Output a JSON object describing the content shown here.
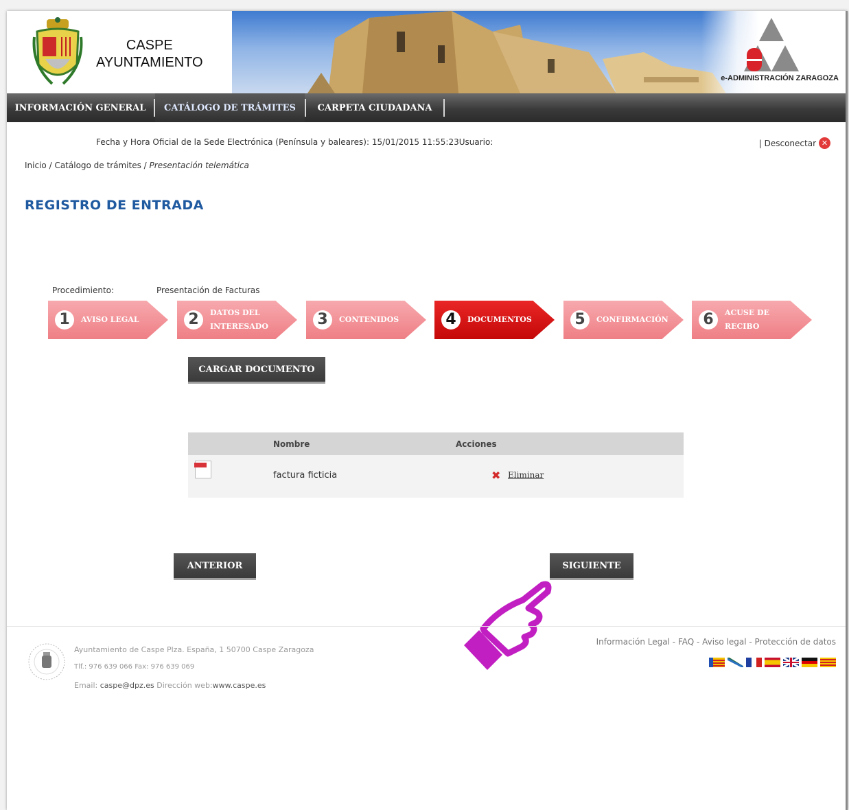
{
  "header": {
    "brand_line1": "CASPE",
    "brand_line2": "AYUNTAMIENTO",
    "eadmin": "e-ADMINISTRACIÓN ZARAGOZA"
  },
  "nav": {
    "items": [
      {
        "label": "INFORMACIÓN GENERAL"
      },
      {
        "label": "CATÁLOGO DE TRÁMITES"
      },
      {
        "label": "CARPETA CIUDADANA"
      }
    ]
  },
  "info": {
    "datetime_label": "Fecha y Hora Oficial de la Sede Electrónica (Península y baleares):",
    "datetime_value": "15/01/2015 11:55:23",
    "user_label": "Usuario:",
    "disconnect": "| Desconectar"
  },
  "breadcrumb": {
    "home": "Inicio",
    "sep": " / ",
    "catalog": "Catálogo de trámites",
    "current": "Presentación telemática"
  },
  "page": {
    "title": "REGISTRO DE ENTRADA",
    "procedure_label": "Procedimiento:",
    "procedure_value": "Presentación de Facturas"
  },
  "steps": [
    {
      "num": "1",
      "label": "AVISO LEGAL"
    },
    {
      "num": "2",
      "label": "DATOS DEL INTERESADO"
    },
    {
      "num": "3",
      "label": "CONTENIDOS"
    },
    {
      "num": "4",
      "label": "DOCUMENTOS"
    },
    {
      "num": "5",
      "label": "CONFIRMACIÓN"
    },
    {
      "num": "6",
      "label": "ACUSE DE RECIBO"
    }
  ],
  "buttons": {
    "upload": "CARGAR DOCUMENTO",
    "prev": "ANTERIOR",
    "next": "SIGUIENTE"
  },
  "table": {
    "col_name": "Nombre",
    "col_actions": "Acciones",
    "rows": [
      {
        "name": "factura ficticia",
        "action": "Eliminar"
      }
    ]
  },
  "footer": {
    "address": "Ayuntamiento de Caspe Plza. España, 1 50700 Caspe Zaragoza",
    "phone": "Tlf.: 976 639 066 Fax: 976 639 069",
    "email_label": "Email:",
    "email": "caspe@dpz.es",
    "web_label": "Dirección web:",
    "web": "www.caspe.es",
    "links": [
      "Información Legal",
      "FAQ",
      "Aviso legal",
      "Protección de datos"
    ]
  },
  "colors": {
    "accent_blue": "#1f5aa0",
    "step_active": "#d01010",
    "step_inactive": "#f08a90",
    "cursor_hand": "#c030c0"
  }
}
